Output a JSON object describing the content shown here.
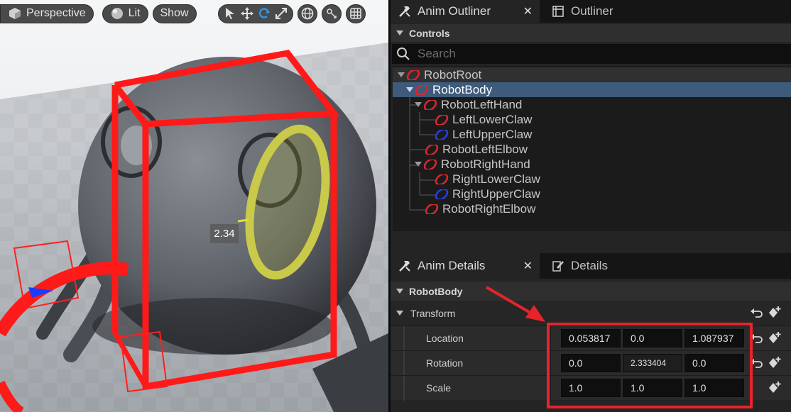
{
  "viewport": {
    "toolbar": {
      "perspective": "Perspective",
      "lit": "Lit",
      "show": "Show"
    },
    "readout": "2.34"
  },
  "anim_outliner": {
    "tab_label": "Anim Outliner",
    "other_tab_label": "Outliner",
    "section": "Controls",
    "search_placeholder": "Search",
    "items": [
      {
        "label": "RobotRoot",
        "color": "#d8262e"
      },
      {
        "label": "RobotBody",
        "color": "#d8262e"
      },
      {
        "label": "RobotLeftHand",
        "color": "#d8262e"
      },
      {
        "label": "LeftLowerClaw",
        "color": "#d8262e"
      },
      {
        "label": "LeftUpperClaw",
        "color": "#2a3fd8"
      },
      {
        "label": "RobotLeftElbow",
        "color": "#d8262e"
      },
      {
        "label": "RobotRightHand",
        "color": "#d8262e"
      },
      {
        "label": "RightLowerClaw",
        "color": "#d8262e"
      },
      {
        "label": "RightUpperClaw",
        "color": "#2a3fd8"
      },
      {
        "label": "RobotRightElbow",
        "color": "#d8262e"
      }
    ]
  },
  "anim_details": {
    "tab_label": "Anim Details",
    "other_tab_label": "Details",
    "control_name": "RobotBody",
    "transform_label": "Transform",
    "location": {
      "label": "Location",
      "x": "0.053817",
      "y": "0.0",
      "z": "1.087937"
    },
    "rotation": {
      "label": "Rotation",
      "x": "0.0",
      "y": "2.333404",
      "z": "0.0"
    },
    "scale": {
      "label": "Scale",
      "x": "1.0",
      "y": "1.0",
      "z": "1.0"
    }
  },
  "colors": {
    "selection": "#3e5b7c",
    "annotation": "#e8232b",
    "control_red": "#d8262e",
    "control_blue": "#2a3fd8"
  }
}
